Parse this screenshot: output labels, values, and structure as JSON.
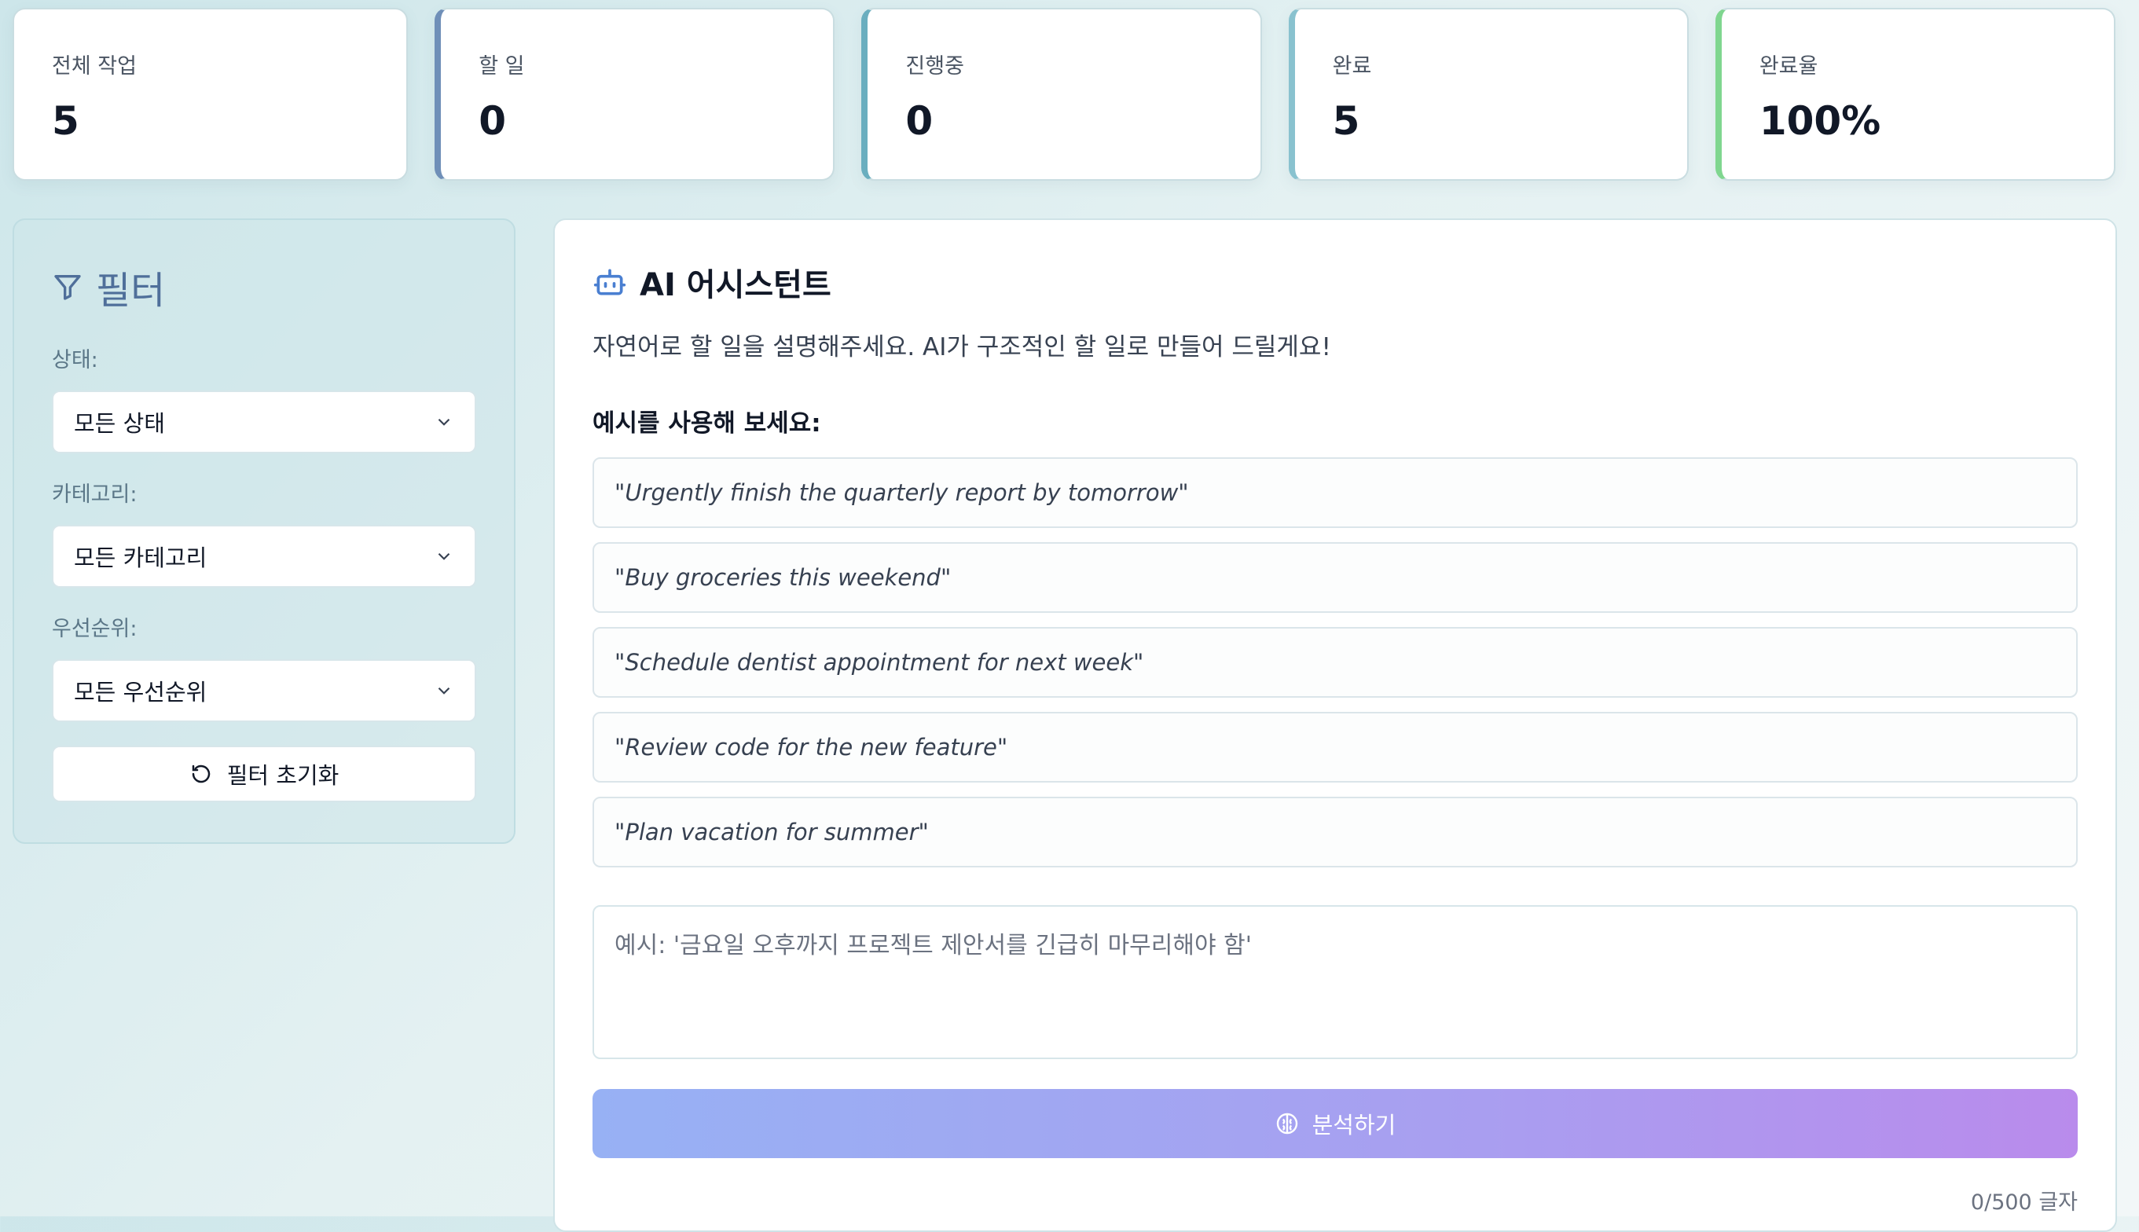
{
  "stats": [
    {
      "label": "전체 작업",
      "value": "5"
    },
    {
      "label": "할 일",
      "value": "0"
    },
    {
      "label": "진행중",
      "value": "0"
    },
    {
      "label": "완료",
      "value": "5"
    },
    {
      "label": "완료율",
      "value": "100%"
    }
  ],
  "colors": {
    "accent_todo": "#6f8fb8",
    "accent_inprogress": "#6aaebf",
    "accent_done": "#89c2cf",
    "accent_rate": "#7fd68f",
    "filter_title": "#4f6f9a",
    "ai_icon": "#4a7fd1",
    "button_gradient_start": "#97b1f4",
    "button_gradient_end": "#b98bec"
  },
  "filters": {
    "title": "필터",
    "icon": "filter-icon",
    "status_label": "상태:",
    "status_value": "모든 상태",
    "category_label": "카테고리:",
    "category_value": "모든 카테고리",
    "priority_label": "우선순위:",
    "priority_value": "모든 우선순위",
    "reset_label": "필터 초기화",
    "reset_icon": "reset-icon"
  },
  "assistant": {
    "title": "AI 어시스턴트",
    "icon": "robot-icon",
    "subtitle": "자연어로 할 일을 설명해주세요. AI가 구조적인 할 일로 만들어 드릴게요!",
    "examples_heading": "예시를 사용해 보세요:",
    "examples": [
      "\"Urgently finish the quarterly report by tomorrow\"",
      "\"Buy groceries this weekend\"",
      "\"Schedule dentist appointment for next week\"",
      "\"Review code for the new feature\"",
      "\"Plan vacation for summer\""
    ],
    "input_placeholder": "예시: '금요일 오후까지 프로젝트 제안서를 긴급히 마무리해야 함'",
    "input_value": "",
    "analyze_label": "분석하기",
    "analyze_icon": "brain-icon",
    "char_count": "0/500 글자"
  }
}
